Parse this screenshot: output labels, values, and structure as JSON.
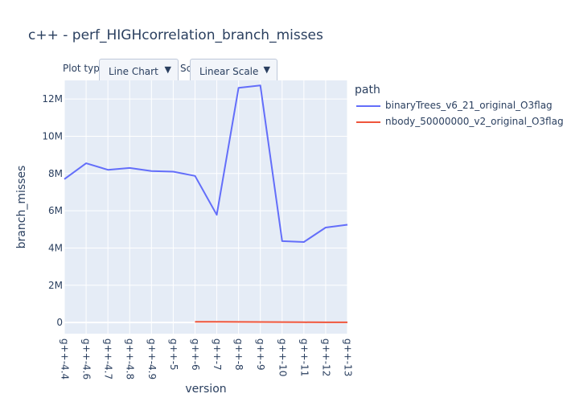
{
  "title": "c++ - perf_HIGHcorrelation_branch_misses",
  "controls": {
    "plot_type_label": "Plot type",
    "plot_type_value": "Line Chart",
    "scale_label": "Scale:",
    "scale_value": "Linear Scale",
    "arrow": "▼"
  },
  "legend": {
    "title": "path",
    "items": [
      {
        "label": "binaryTrees_v6_21_original_O3flag",
        "color": "#636efa"
      },
      {
        "label": "nbody_50000000_v2_original_O3flag",
        "color": "#ef553b"
      }
    ]
  },
  "colors": {
    "plot_bg": "#e5ecf6",
    "grid": "#ffffff",
    "text": "#2a3f5f"
  },
  "chart_data": {
    "type": "line",
    "title": "c++ - perf_HIGHcorrelation_branch_misses",
    "xlabel": "version",
    "ylabel": "branch_misses",
    "categories": [
      "g++-4.4",
      "g++-4.6",
      "g++-4.7",
      "g++-4.8",
      "g++-4.9",
      "g++-5",
      "g++-6",
      "g++-7",
      "g++-8",
      "g++-9",
      "g++-10",
      "g++-11",
      "g++-12",
      "g++-13"
    ],
    "ylim": [
      -600000,
      13000000
    ],
    "yticks": [
      0,
      2000000,
      4000000,
      6000000,
      8000000,
      10000000,
      12000000
    ],
    "ytick_labels": [
      "0",
      "2M",
      "4M",
      "6M",
      "8M",
      "10M",
      "12M"
    ],
    "grid": true,
    "legend_position": "right",
    "series": [
      {
        "name": "binaryTrees_v6_21_original_O3flag",
        "values": [
          7700000,
          8550000,
          8200000,
          8300000,
          8130000,
          8100000,
          7870000,
          5780000,
          12600000,
          12730000,
          4370000,
          4320000,
          5100000,
          5250000
        ]
      },
      {
        "name": "nbody_50000000_v2_original_O3flag",
        "values": [
          null,
          null,
          null,
          null,
          null,
          null,
          40000,
          35000,
          30000,
          25000,
          20000,
          15000,
          10000,
          10000
        ]
      }
    ]
  }
}
